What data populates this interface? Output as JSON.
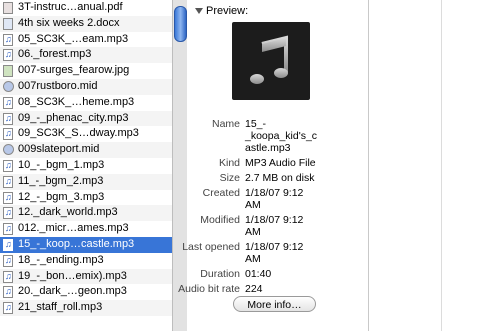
{
  "files": [
    {
      "name": "3T-instruc…anual.pdf",
      "type": "pdf"
    },
    {
      "name": "4th six weeks 2.docx",
      "type": "doc"
    },
    {
      "name": "05_SC3K_…eam.mp3",
      "type": "mp3"
    },
    {
      "name": "06._forest.mp3",
      "type": "mp3"
    },
    {
      "name": "007-surges_fearow.jpg",
      "type": "img"
    },
    {
      "name": "007rustboro.mid",
      "type": "mid"
    },
    {
      "name": "08_SC3K_…heme.mp3",
      "type": "mp3"
    },
    {
      "name": "09_-_phenac_city.mp3",
      "type": "mp3"
    },
    {
      "name": "09_SC3K_S…dway.mp3",
      "type": "mp3"
    },
    {
      "name": "009slateport.mid",
      "type": "mid"
    },
    {
      "name": "10_-_bgm_1.mp3",
      "type": "mp3"
    },
    {
      "name": "11_-_bgm_2.mp3",
      "type": "mp3"
    },
    {
      "name": "12_-_bgm_3.mp3",
      "type": "mp3"
    },
    {
      "name": "12._dark_world.mp3",
      "type": "mp3"
    },
    {
      "name": "012._micr…ames.mp3",
      "type": "mp3"
    },
    {
      "name": "15_-_koop…castle.mp3",
      "type": "mp3",
      "selected": true
    },
    {
      "name": "18_-_ending.mp3",
      "type": "mp3"
    },
    {
      "name": "19_-_bon…emix).mp3",
      "type": "mp3"
    },
    {
      "name": "20._dark_…geon.mp3",
      "type": "mp3"
    },
    {
      "name": "21_staff_roll.mp3",
      "type": "mp3"
    }
  ],
  "preview": {
    "header": "Preview:",
    "thumbnail_icon": "music-note-icon",
    "info": [
      {
        "label": "Name",
        "value": "15_-\n_koopa_kid's_c\nastle.mp3"
      },
      {
        "label": "Kind",
        "value": "MP3 Audio File"
      },
      {
        "label": "Size",
        "value": "2.7 MB on disk"
      },
      {
        "label": "Created",
        "value": "1/18/07 9:12\nAM"
      },
      {
        "label": "Modified",
        "value": "1/18/07 9:12\nAM"
      },
      {
        "label": "Last opened",
        "value": "1/18/07 9:12\nAM"
      },
      {
        "label": "Duration",
        "value": "01:40"
      },
      {
        "label": "Audio bit rate",
        "value": "224"
      }
    ],
    "more_info_label": "More info…"
  },
  "colors": {
    "selection": "#3875d7",
    "scroll_thumb": "#3a78d8"
  }
}
